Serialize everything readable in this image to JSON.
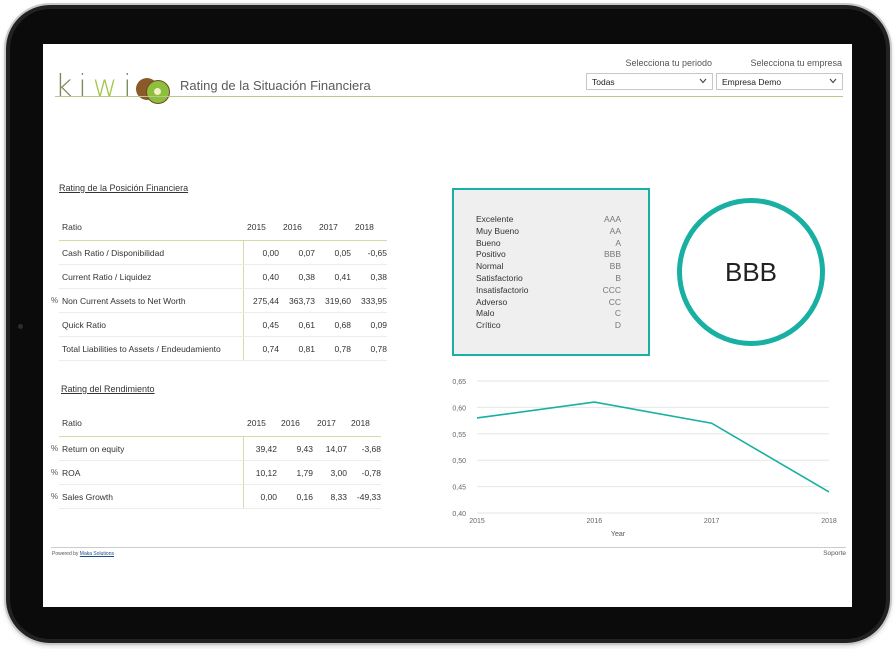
{
  "header": {
    "logo_letters": [
      "k",
      "i",
      "w",
      "i"
    ],
    "logo_icon": "kiwi-fruit-icon",
    "title": "Rating de la Situación Financiera"
  },
  "filters": {
    "period": {
      "label": "Selecciona tu periodo",
      "value": "Todas"
    },
    "company": {
      "label": "Selecciona tu empresa",
      "value": "Empresa Demo"
    }
  },
  "position_table": {
    "title": "Rating de la Posición Financiera",
    "headers": [
      "Ratio",
      "2015",
      "2016",
      "2017",
      "2018"
    ],
    "rows": [
      {
        "pct": "",
        "name": "Cash Ratio / Disponibilidad",
        "values": [
          "0,00",
          "0,07",
          "0,05",
          "-0,65"
        ]
      },
      {
        "pct": "",
        "name": "Current Ratio / Liquidez",
        "values": [
          "0,40",
          "0,38",
          "0,41",
          "0,38"
        ]
      },
      {
        "pct": "%",
        "name": "Non Current Assets to Net Worth",
        "values": [
          "275,44",
          "363,73",
          "319,60",
          "333,95"
        ]
      },
      {
        "pct": "",
        "name": "Quick Ratio",
        "values": [
          "0,45",
          "0,61",
          "0,68",
          "0,09"
        ]
      },
      {
        "pct": "",
        "name": "Total Liabilities to Assets / Endeudamiento",
        "values": [
          "0,74",
          "0,81",
          "0,78",
          "0,78"
        ]
      }
    ]
  },
  "performance_table": {
    "title": "Rating del Rendimiento",
    "headers": [
      "Ratio",
      "2015",
      "2016",
      "2017",
      "2018"
    ],
    "rows": [
      {
        "pct": "%",
        "name": "Return on equity",
        "values": [
          "39,42",
          "9,43",
          "14,07",
          "-3,68"
        ]
      },
      {
        "pct": "%",
        "name": "ROA",
        "values": [
          "10,12",
          "1,79",
          "3,00",
          "-0,78"
        ]
      },
      {
        "pct": "%",
        "name": "Sales Growth",
        "values": [
          "0,00",
          "0,16",
          "8,33",
          "-49,33"
        ]
      }
    ]
  },
  "rating_legend": [
    {
      "label": "Excelente",
      "code": "AAA"
    },
    {
      "label": "Muy Bueno",
      "code": "AA"
    },
    {
      "label": "Bueno",
      "code": "A"
    },
    {
      "label": "Positivo",
      "code": "BBB"
    },
    {
      "label": "Normal",
      "code": "BB"
    },
    {
      "label": "Satisfactorio",
      "code": "B"
    },
    {
      "label": "Insatisfactorio",
      "code": "CCC"
    },
    {
      "label": "Adverso",
      "code": "CC"
    },
    {
      "label": "Malo",
      "code": "C"
    },
    {
      "label": "Crítico",
      "code": "D"
    }
  ],
  "rating_value": "BBB",
  "accent_color": "#18b0a2",
  "chart_data": {
    "type": "line",
    "x": [
      2015,
      2016,
      2017,
      2018
    ],
    "x_tick_labels": [
      "2015",
      "2016",
      "2017",
      "2018"
    ],
    "series": [
      {
        "values": [
          0.58,
          0.61,
          0.57,
          0.44
        ]
      }
    ],
    "xlabel": "Year",
    "ylabel": "",
    "ylim": [
      0.4,
      0.65
    ],
    "y_ticks": [
      "0,40",
      "0,45",
      "0,50",
      "0,55",
      "0,60",
      "0,65"
    ],
    "grid": true,
    "line_color": "#18b0a2"
  },
  "footer": {
    "powered_prefix": "Powered by",
    "powered_link": "Maka Solutions",
    "support": "Soporte"
  }
}
